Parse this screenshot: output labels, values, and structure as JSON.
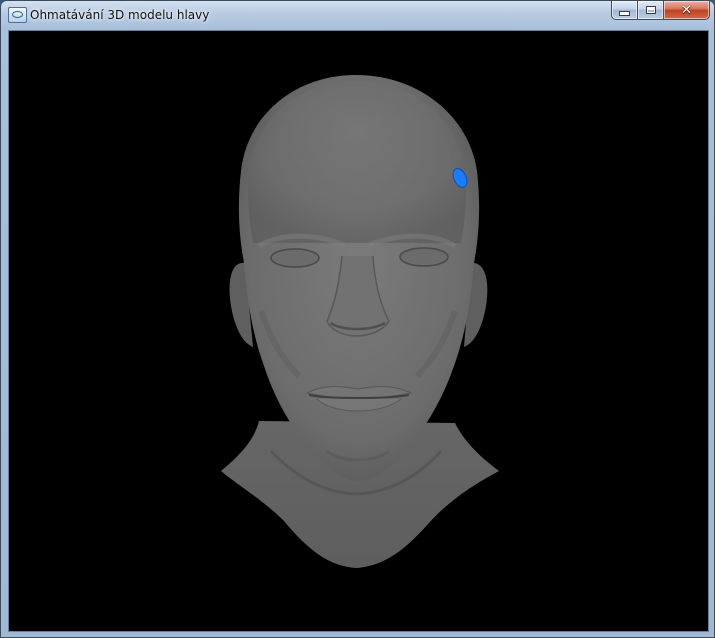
{
  "window": {
    "title": "Ohmatávání 3D modelu hlavy",
    "icon": "app-window-icon",
    "buttons": {
      "minimize": "minimize-icon",
      "maximize": "maximize-icon",
      "close": "close-icon",
      "close_glyph": "✕"
    }
  },
  "viewport": {
    "background": "#000000",
    "model": "3D head model",
    "model_color": "#6e6e6e",
    "marker_color": "#1a7cff"
  }
}
